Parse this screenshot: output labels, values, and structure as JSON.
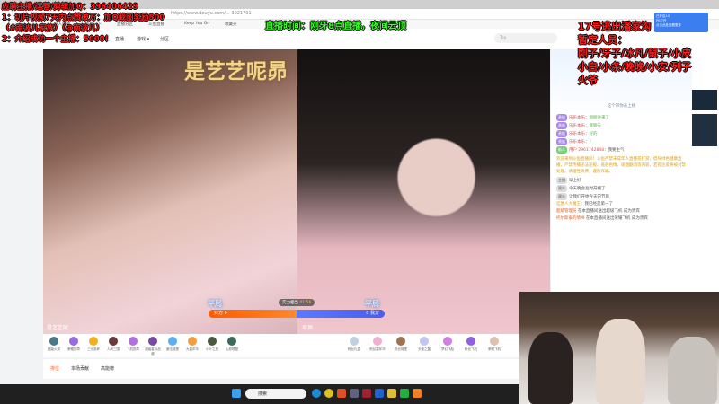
{
  "browser": {
    "address": "https://www.douyu.com/… 3021701"
  },
  "bookmarks": [
    "导入收藏",
    "百度一下",
    "直播分区",
    "斗鱼直播",
    "Keep You On",
    "收藏夹"
  ],
  "site_nav": {
    "items": [
      "直播",
      "游戏 ▾",
      "分区"
    ],
    "search_placeholder": "Tco"
  },
  "video": {
    "overlay_title": "是艺艺呢昴",
    "left_result": "平局",
    "right_result": "平局",
    "pk_status": "实力相当",
    "pk_timer": "01:56",
    "opponent_score": "对方 0",
    "our_score": "0 我方",
    "left_streamer": "是艺艺呢",
    "right_streamer": "早恒"
  },
  "gifts_left": [
    "超级火箭",
    "荣耀勋章",
    "三元奖杯",
    "人间三国",
    "飞机勋章",
    "超级星际战舰",
    "魔法城堡",
    "大嘉年华",
    "小叶之旅",
    "心愿联盟"
  ],
  "gifts_right": [
    "粉丝礼盒",
    "粉丝嘉年华",
    "粉丝城堡",
    "天使之翼",
    "梦幻飞船",
    "粉丝飞机",
    "荣耀飞机"
  ],
  "tabs": [
    "排位",
    "本场贡献",
    "高能榜"
  ],
  "chat": {
    "banner": "这个带你去上榜",
    "messages": [
      {
        "badge": "贵族",
        "user": "乐乐本乐",
        "text": "刚刚进来了"
      },
      {
        "badge": "贵族",
        "user": "乐乐本乐",
        "text": "聊聊天"
      },
      {
        "badge": "贵族",
        "user": "乐乐本乐",
        "text": "好的"
      },
      {
        "badge": "贵族",
        "user": "乐乐本乐",
        "text": "?"
      },
      {
        "badge": "新人",
        "user": "用户 2961742848",
        "text": "我要生气"
      }
    ],
    "system": "欢迎来到斗鱼直播间！斗鱼严禁未成年人直播或打赏，倡导绿色健康直播，严禁传播违法违规、低俗色情、吸烟酗酒等内容，若有违反将被封禁处理。请理性消费，谨防诈骗。",
    "plain": [
      {
        "tag": "主播",
        "text": "早上好"
      },
      {
        "tag": "观众",
        "text": "今天晚会准时开播了"
      },
      {
        "tag": "观众",
        "text": "让我们开始今天的节目"
      }
    ],
    "more": [
      {
        "user": "哇塞人大魔王",
        "text": "我已经是第一了"
      },
      {
        "user": "超级管理员",
        "text": "在本直播间送出超级飞机 成为贵宾"
      },
      {
        "user": "托尔斯泰的情书",
        "text": "在本直播间送出荣耀飞机 成为贵宾"
      }
    ]
  },
  "overlay_left": [
    "应聘主播/运营/剪辑加Q：396406429",
    "1：切片视频7天内点赞破万：加Q截图奖励500",
    "（#南波儿家族）（@南波儿）",
    "2：介绍成功一个主播：5000！"
  ],
  "overlay_middle": "直播时间：刚牙8点直播，夜间云顶",
  "overlay_right": [
    "17号逃出潘家沟",
    "暂定人员：",
    "刚子/牙子/冰凡/鼠子/小皮",
    "小白/小条/晚晚/小安/列子",
    "火爷"
  ],
  "plugin": {
    "line1": "已开启1X",
    "line2": "PK打开",
    "line3": "点击此处查看更多"
  },
  "taskbar": {
    "search": "搜索"
  },
  "colors": {
    "accent": "#ff5d23",
    "pk_left": "#ff5a00",
    "pk_right": "#4a5ef0"
  }
}
